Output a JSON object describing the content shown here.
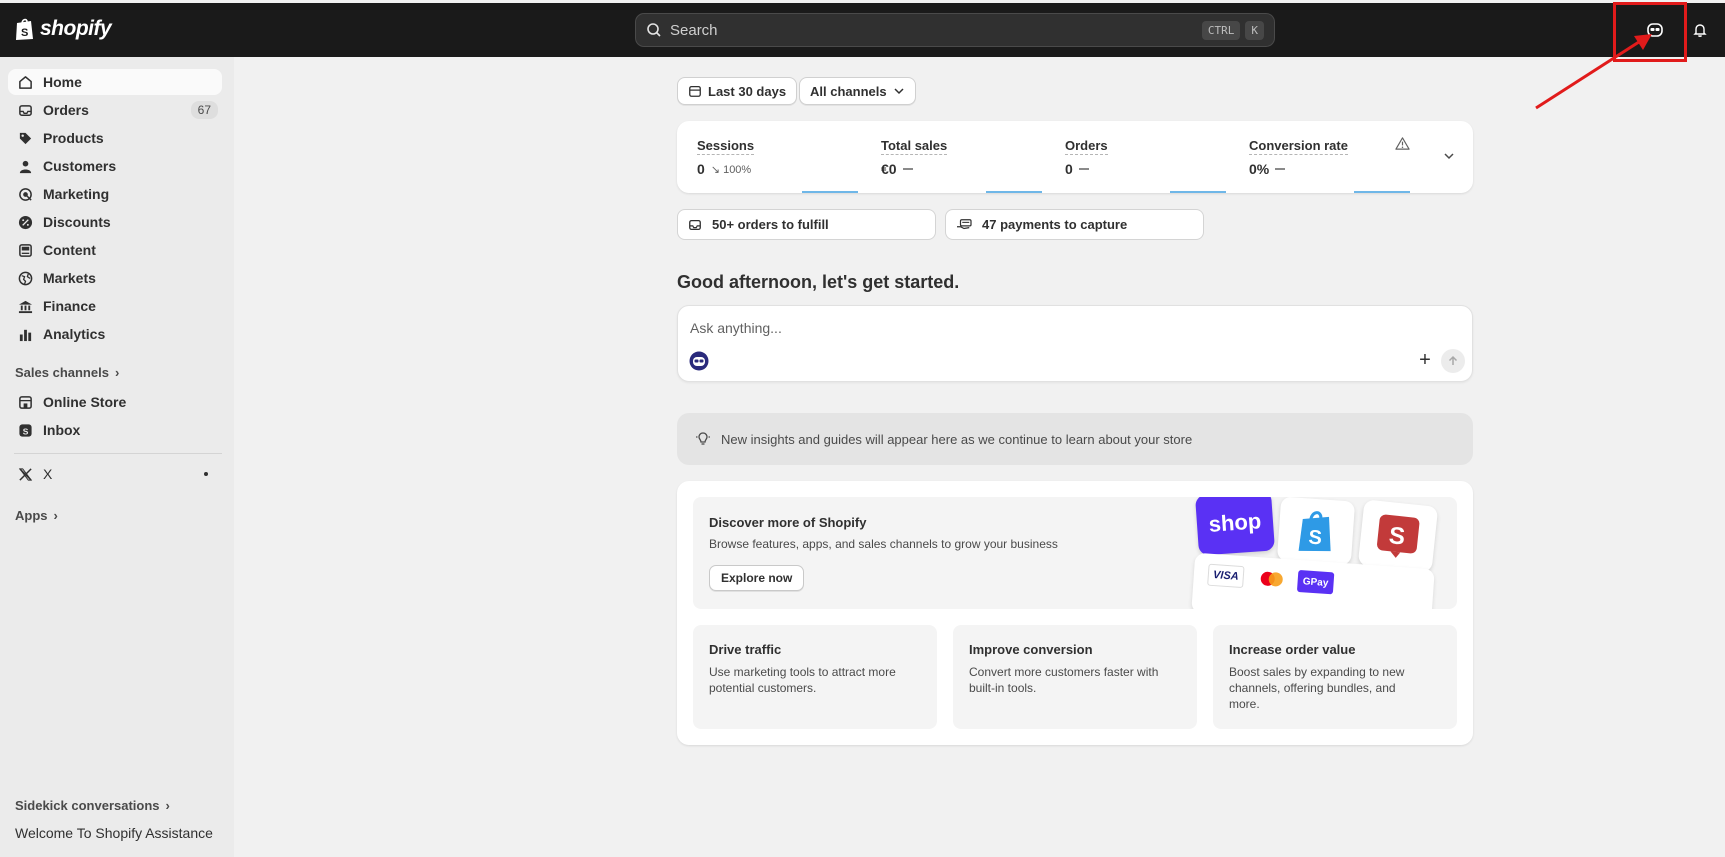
{
  "topbar": {
    "logo_text": "shopify",
    "search_placeholder": "Search",
    "shortcut_keys": [
      "CTRL",
      "K"
    ],
    "icons": [
      "sidekick-icon",
      "bell-icon"
    ]
  },
  "sidebar": {
    "items": [
      {
        "label": "Home",
        "icon": "home-icon",
        "active": true
      },
      {
        "label": "Orders",
        "icon": "inbox-icon",
        "badge": "67"
      },
      {
        "label": "Products",
        "icon": "tag-icon"
      },
      {
        "label": "Customers",
        "icon": "person-icon"
      },
      {
        "label": "Marketing",
        "icon": "target-icon"
      },
      {
        "label": "Discounts",
        "icon": "discount-icon"
      },
      {
        "label": "Content",
        "icon": "content-icon"
      },
      {
        "label": "Markets",
        "icon": "globe-icon"
      },
      {
        "label": "Finance",
        "icon": "bank-icon"
      },
      {
        "label": "Analytics",
        "icon": "bar-chart-icon"
      }
    ],
    "sales_channels_label": "Sales channels",
    "channels": [
      {
        "label": "Online Store",
        "icon": "store-icon"
      },
      {
        "label": "Inbox",
        "icon": "shopify-inbox-icon"
      }
    ],
    "x_app_label": "X",
    "apps_label": "Apps",
    "sidekick_conversations_label": "Sidekick conversations",
    "conversation_item": "Welcome To Shopify Assistance"
  },
  "filters": {
    "date_range": "Last 30 days",
    "channel": "All channels"
  },
  "metrics": [
    {
      "title": "Sessions",
      "value": "0",
      "sub": "↘ 100%"
    },
    {
      "title": "Total sales",
      "value": "€0",
      "sub": ""
    },
    {
      "title": "Orders",
      "value": "0",
      "sub": ""
    },
    {
      "title": "Conversion rate",
      "value": "0%",
      "sub": ""
    }
  ],
  "tasks": {
    "fulfill": "50+ orders to fulfill",
    "capture": "47 payments to capture"
  },
  "greeting": "Good afternoon, let's get started.",
  "ask": {
    "placeholder": "Ask anything..."
  },
  "insights_text": "New insights and guides will appear here as we continue to learn about your store",
  "discover": {
    "title": "Discover more of Shopify",
    "description": "Browse features, apps, and sales channels to grow your business",
    "button": "Explore now",
    "shop_tile": "shop",
    "visa_label": "VISA",
    "gpay_label": "GPay"
  },
  "cards": [
    {
      "title": "Drive traffic",
      "desc": "Use marketing tools to attract more potential customers."
    },
    {
      "title": "Improve conversion",
      "desc": "Convert more customers faster with built-in tools."
    },
    {
      "title": "Increase order value",
      "desc": "Boost sales by expanding to new channels, offering bundles, and more."
    }
  ],
  "colors": {
    "topbar": "#1a1a1a",
    "annotation": "#e11b1b",
    "shop_purple": "#5a31f4",
    "sparkline": "#6fb7e8"
  }
}
